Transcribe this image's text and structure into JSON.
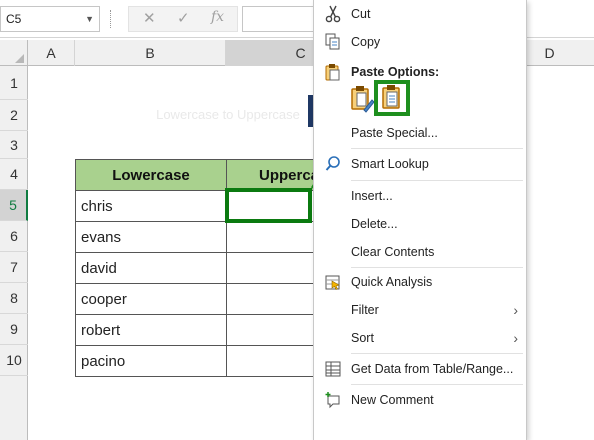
{
  "formula_bar": {
    "name_box": "C5",
    "dropdown_glyph": "▼",
    "cancel_glyph": "✕",
    "enter_glyph": "✓",
    "fx_glyph": "fx",
    "formula_value": ""
  },
  "columns": [
    "A",
    "B",
    "C",
    "D"
  ],
  "rows": [
    "1",
    "2",
    "3",
    "4",
    "5",
    "6",
    "7",
    "8",
    "9",
    "10"
  ],
  "selected_row": "5",
  "sheet": {
    "title_text": "Lowercase to Uppercase",
    "table": {
      "headers": [
        "Lowercase",
        "Uppercase"
      ],
      "values": [
        "chris",
        "evans",
        "david",
        "cooper",
        "robert",
        "pacino"
      ]
    }
  },
  "context_menu": {
    "items": [
      {
        "id": "cut",
        "label": "Cut",
        "icon": "scissors-icon"
      },
      {
        "id": "copy",
        "label": "Copy",
        "icon": "copy-icon"
      },
      {
        "id": "paste_options",
        "label": "Paste Options:",
        "icon": "clipboard-icon"
      },
      {
        "id": "paste_special",
        "label": "Paste Special...",
        "icon": ""
      },
      {
        "id": "smart_lookup",
        "label": "Smart Lookup",
        "icon": "search-icon"
      },
      {
        "id": "insert",
        "label": "Insert...",
        "icon": ""
      },
      {
        "id": "delete",
        "label": "Delete...",
        "icon": ""
      },
      {
        "id": "clear_contents",
        "label": "Clear Contents",
        "icon": ""
      },
      {
        "id": "quick_analysis",
        "label": "Quick Analysis",
        "icon": "quick-analysis-icon"
      },
      {
        "id": "filter",
        "label": "Filter",
        "icon": "",
        "submenu": true
      },
      {
        "id": "sort",
        "label": "Sort",
        "icon": "",
        "submenu": true
      },
      {
        "id": "get_data",
        "label": "Get Data from Table/Range...",
        "icon": "table-icon"
      },
      {
        "id": "new_comment",
        "label": "New Comment",
        "icon": "comment-icon"
      }
    ],
    "submenu_glyph": "›"
  },
  "colors": {
    "header_fill": "#a9d18e",
    "highlight_green": "#0b7a10",
    "selected_row_text": "#107c41"
  }
}
